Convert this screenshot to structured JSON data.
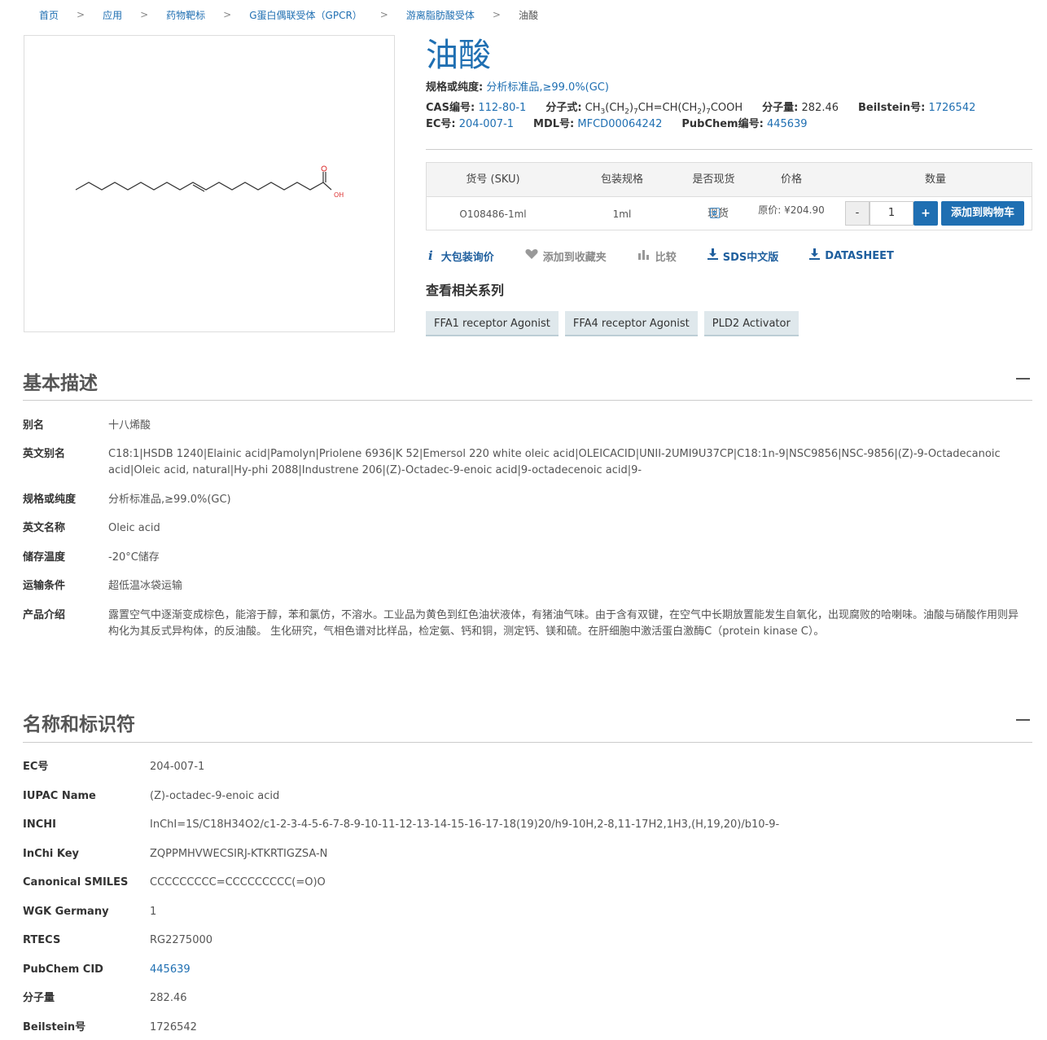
{
  "breadcrumb": {
    "items": [
      "首页",
      "应用",
      "药物靶标",
      "G蛋白偶联受体（GPCR）",
      "游离脂肪酸受体",
      "油酸"
    ]
  },
  "product": {
    "title": "油酸",
    "spec_label": "规格或纯度:",
    "spec_value": "分析标准品,≥99.0%(GC)",
    "cas_label": "CAS编号:",
    "cas_value": "112-80-1",
    "formula_label": "分子式:",
    "mw_label": "分子量:",
    "mw_value": "282.46",
    "beilstein_label": "Beilstein号:",
    "beilstein_value": "1726542",
    "ec_label": "EC号:",
    "ec_value": "204-007-1",
    "mdl_label": "MDL号:",
    "mdl_value": "MFCD00064242",
    "pubchem_label": "PubChem编号:",
    "pubchem_value": "445639",
    "structure_label": "OH"
  },
  "sku_table": {
    "headers": [
      "货号 (SKU)",
      "包装规格",
      "是否现货",
      "价格",
      "数量"
    ],
    "row": {
      "sku": "O108486-1ml",
      "pack": "1ml",
      "stock": "现货",
      "price": "原价: ¥204.90",
      "qty": "1",
      "minus": "-",
      "plus": "+",
      "add_cart": "添加到购物车"
    }
  },
  "actions": {
    "bulk": "大包装询价",
    "favorite": "添加到收藏夹",
    "compare": "比较",
    "sds": "SDS中文版",
    "datasheet": "DATASHEET"
  },
  "related": {
    "title": "查看相关系列",
    "tags": [
      "FFA1 receptor Agonist",
      "FFA4 receptor Agonist",
      "PLD2 Activator"
    ]
  },
  "basic": {
    "title": "基本描述",
    "rows": [
      {
        "k": "别名",
        "v": "十八烯酸"
      },
      {
        "k": "英文别名",
        "v": "C18:1|HSDB 1240|Elainic acid|Pamolyn|Priolene 6936|K 52|Emersol 220 white oleic acid|OLEICACID|UNII-2UMI9U37CP|C18:1n-9|NSC9856|NSC-9856|(Z)-9-Octadecanoic acid|Oleic acid, natural|Hy-phi 2088|Industrene 206|(Z)-Octadec-9-enoic acid|9-octadecenoic acid|9-"
      },
      {
        "k": "规格或纯度",
        "v": "分析标准品,≥99.0%(GC)"
      },
      {
        "k": "英文名称",
        "v": "Oleic acid"
      },
      {
        "k": "储存温度",
        "v": "-20°C储存"
      },
      {
        "k": "运输条件",
        "v": "超低温冰袋运输"
      },
      {
        "k": "产品介绍",
        "v": "露置空气中逐渐变成棕色，能溶于醇，苯和氯仿，不溶水。工业品为黄色到红色油状液体，有猪油气味。由于含有双键，在空气中长期放置能发生自氧化，出现腐败的哈喇味。油酸与硝酸作用则异构化为其反式异构体，的反油酸。 生化研究，气相色谱对比样品，检定氨、钙和铜，测定钙、镁和硫。在肝细胞中激活蛋白激酶C（protein kinase C）。"
      }
    ]
  },
  "ident": {
    "title": "名称和标识符",
    "rows": [
      {
        "k": "EC号",
        "v": "204-007-1"
      },
      {
        "k": "IUPAC Name",
        "v": "(Z)-octadec-9-enoic acid"
      },
      {
        "k": "INCHI",
        "v": "InChI=1S/C18H34O2/c1-2-3-4-5-6-7-8-9-10-11-12-13-14-15-16-17-18(19)20/h9-10H,2-8,11-17H2,1H3,(H,19,20)/b10-9-"
      },
      {
        "k": "InChi Key",
        "v": "ZQPPMHVWECSIRJ-KTKRTIGZSA-N"
      },
      {
        "k": "Canonical SMILES",
        "v": "CCCCCCCCC=CCCCCCCCC(=O)O"
      },
      {
        "k": "WGK Germany",
        "v": "1"
      },
      {
        "k": "RTECS",
        "v": "RG2275000"
      },
      {
        "k": "PubChem CID",
        "v": "445639"
      },
      {
        "k": "分子量",
        "v": "282.46"
      },
      {
        "k": "Beilstein号",
        "v": "1726542"
      }
    ]
  }
}
